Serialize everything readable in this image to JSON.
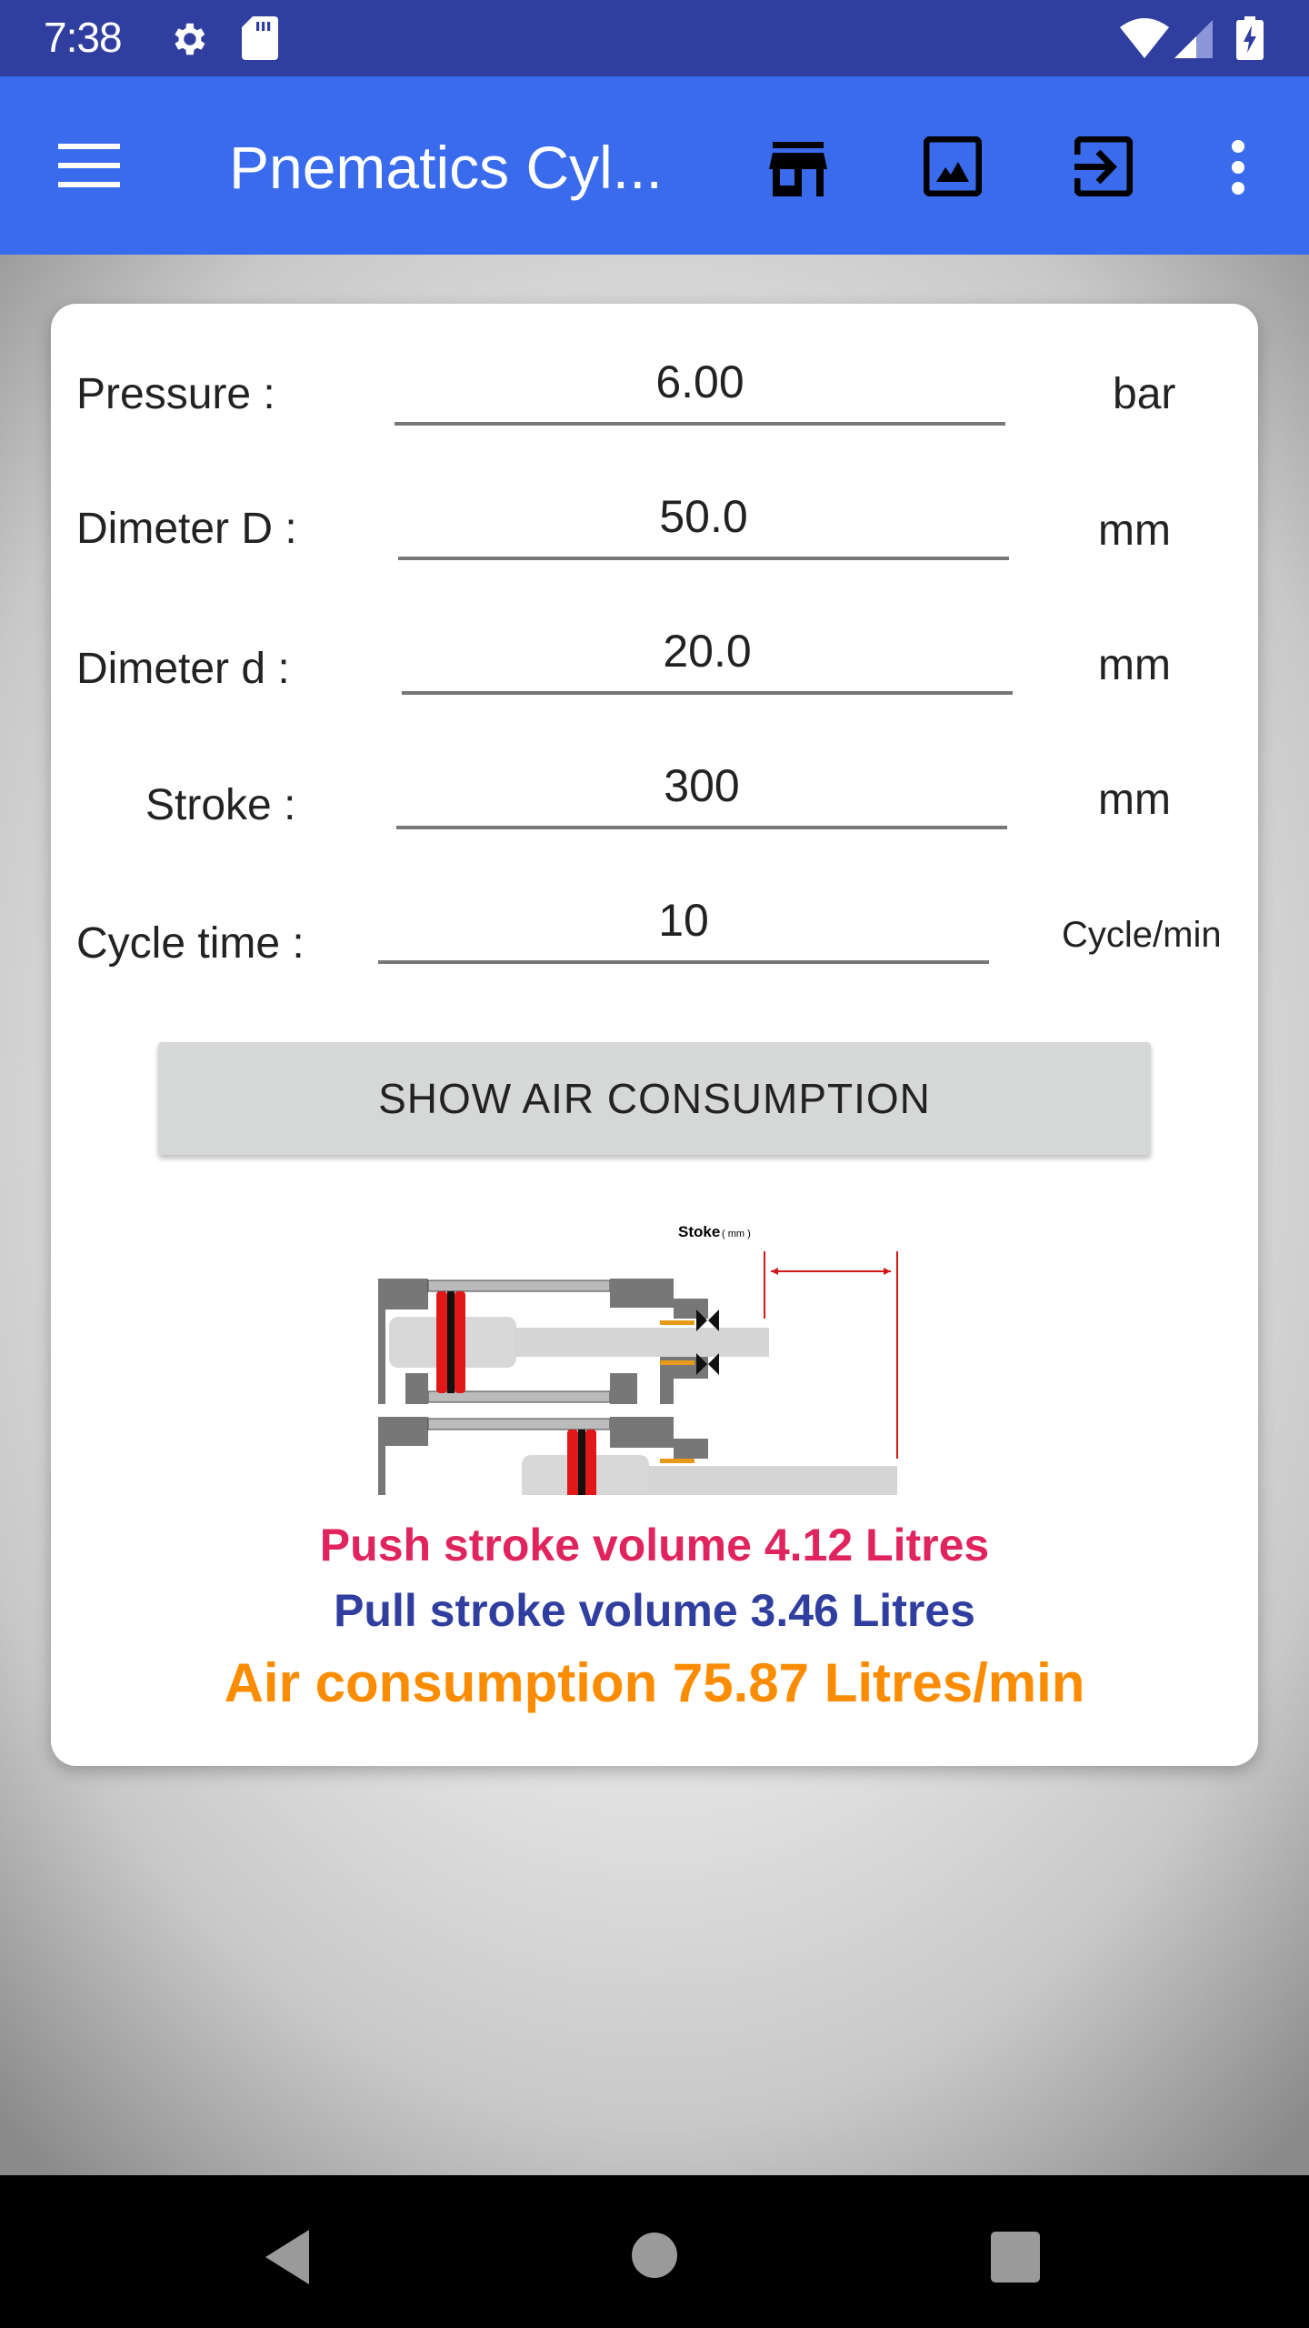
{
  "status_bar": {
    "time": "7:38",
    "icons": [
      "settings-icon",
      "sd-card-icon",
      "wifi-icon",
      "signal-icon",
      "battery-charging-icon"
    ]
  },
  "app_bar": {
    "title": "Pnematics Cyl...",
    "icons": [
      "menu-icon",
      "store-icon",
      "image-icon",
      "exit-to-app-icon",
      "more-vert-icon"
    ]
  },
  "form": {
    "rows": [
      {
        "label": "Pressure :",
        "value": "6.00",
        "unit": "bar"
      },
      {
        "label": "Dimeter D :",
        "value": "50.0",
        "unit": "mm"
      },
      {
        "label": "Dimeter d :",
        "value": "20.0",
        "unit": "mm"
      },
      {
        "label": "Stroke :",
        "value": "300",
        "unit": "mm"
      },
      {
        "label": "Cycle time :",
        "value": "10",
        "unit": "Cycle/min"
      }
    ],
    "button_label": "SHOW AIR CONSUMPTION"
  },
  "diagram": {
    "stroke_label": "Stoke",
    "stroke_unit": "( mm )"
  },
  "results": {
    "push": "Push stroke volume 4.12 Litres",
    "pull": "Pull stroke volume 3.46 Litres",
    "air": "Air consumption 75.87 Litres/min"
  },
  "colors": {
    "status_bar": "#303f9f",
    "app_bar": "#3a6bec",
    "push": "#e0245e",
    "pull": "#303f9f",
    "air": "#fb8c00"
  },
  "nav_bar": {
    "icons": [
      "back-icon",
      "home-icon",
      "recents-icon"
    ]
  }
}
